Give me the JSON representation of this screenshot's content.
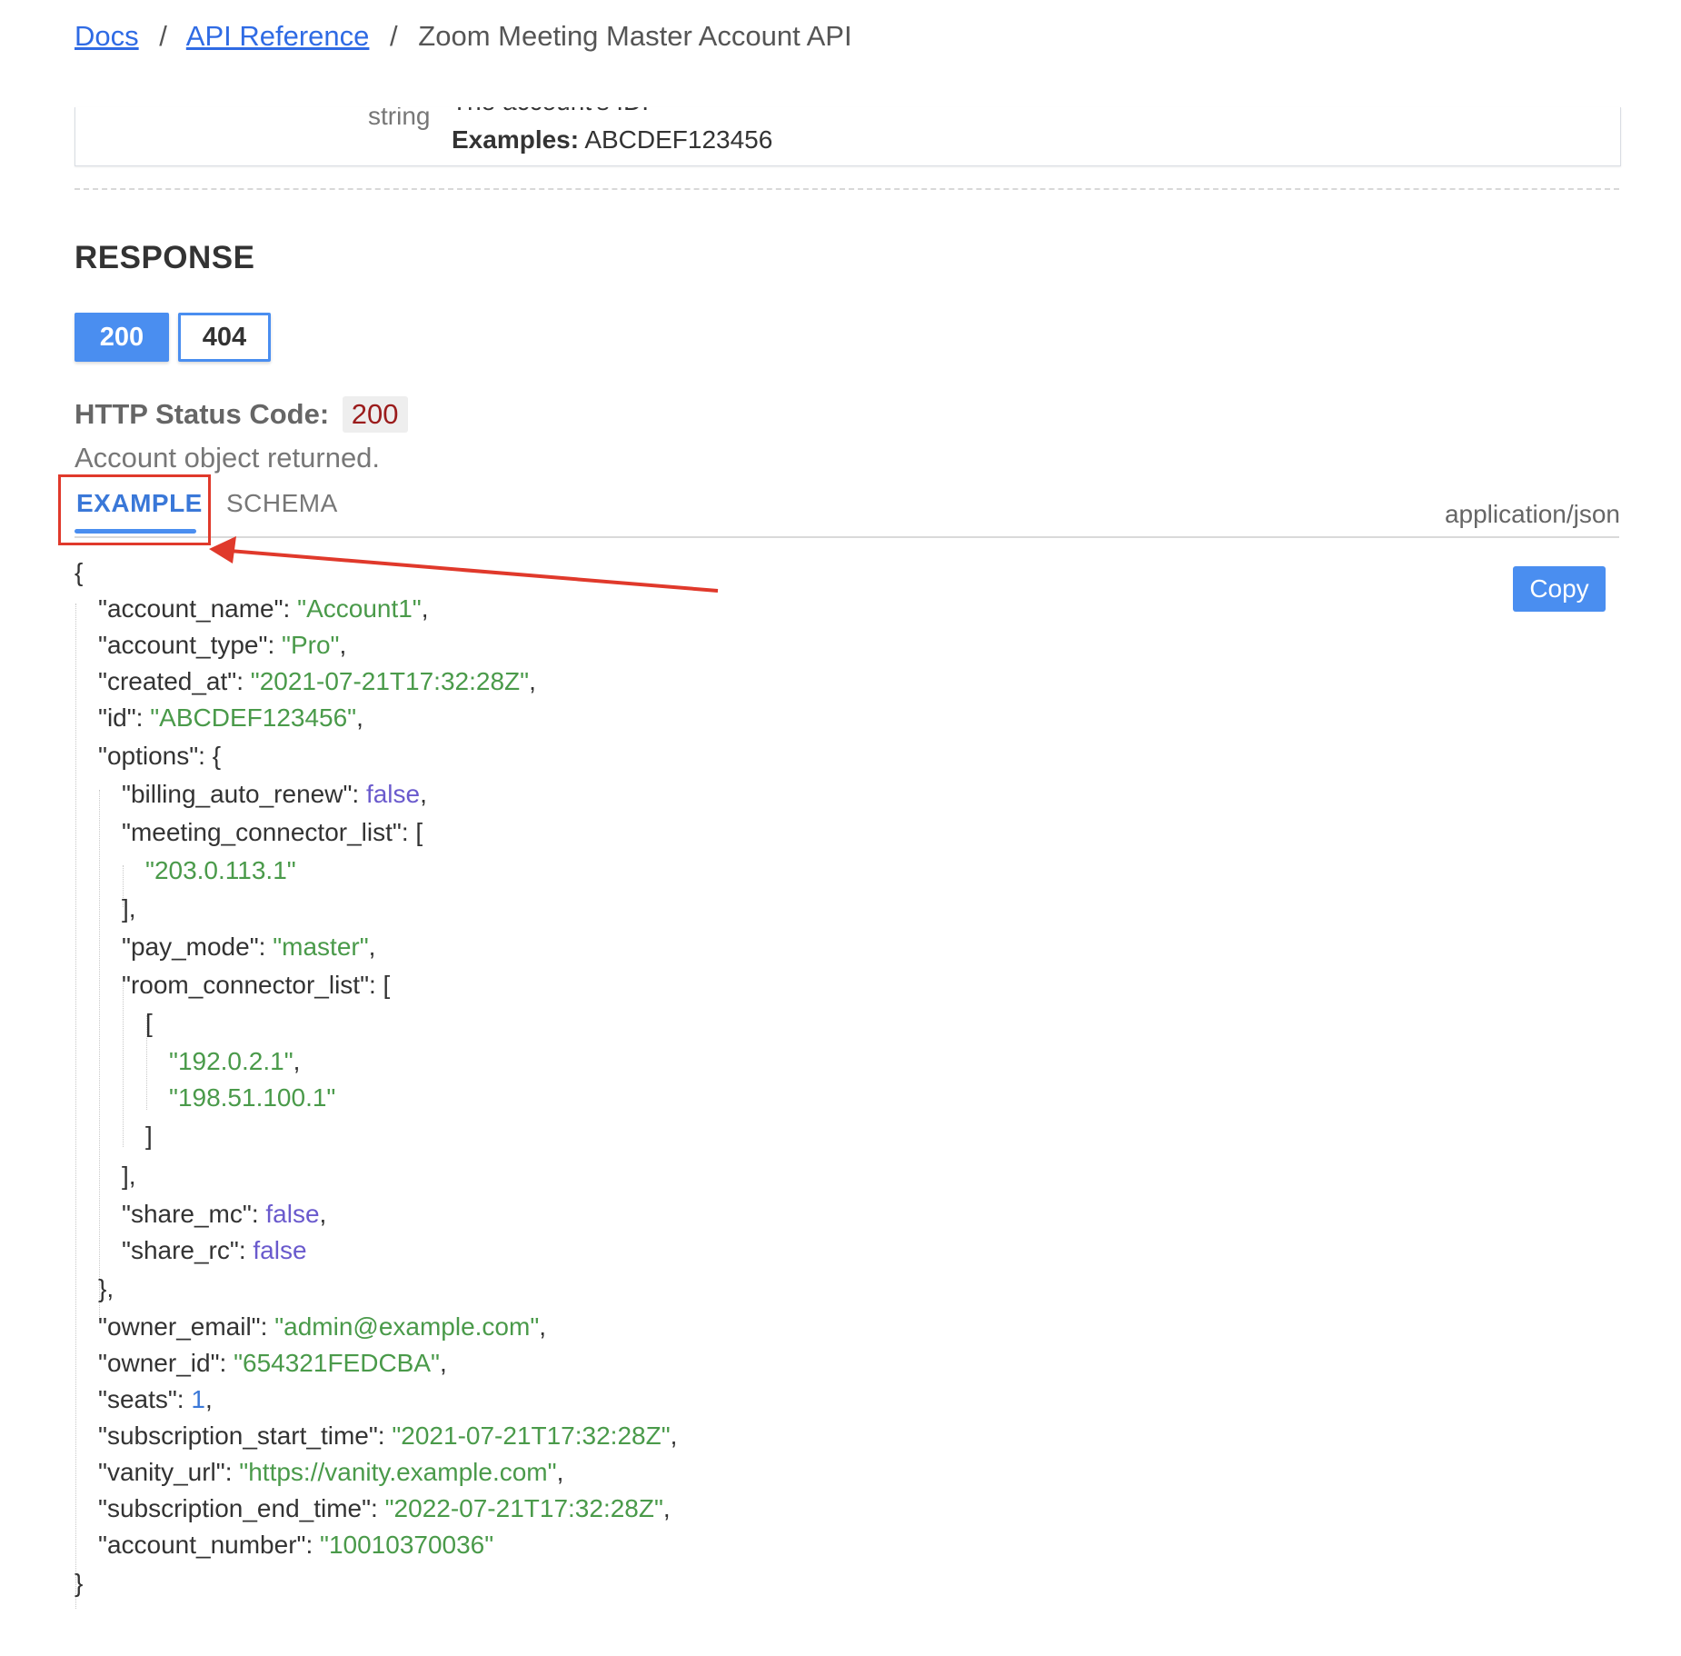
{
  "breadcrumb": {
    "docs": "Docs",
    "api_reference": "API Reference",
    "current": "Zoom Meeting Master Account API",
    "separator": "/"
  },
  "param": {
    "type": "string",
    "description_cut": "The account's ID.",
    "examples_label": "Examples:",
    "examples_value": "ABCDEF123456"
  },
  "response": {
    "title": "RESPONSE",
    "codes": [
      "200",
      "404"
    ],
    "status_label": "HTTP Status Code:",
    "status_value": "200",
    "status_description": "Account object returned.",
    "tabs": {
      "example": "EXAMPLE",
      "schema": "SCHEMA"
    },
    "content_type": "application/json",
    "copy_label": "Copy"
  },
  "json": {
    "open": "{",
    "close": "}",
    "account_name": "\"Account1\"",
    "account_type": "\"Pro\"",
    "created_at": "\"2021-07-21T17:32:28Z\"",
    "id": "\"ABCDEF123456\"",
    "billing_auto_renew": "false",
    "meeting_connector_ip": "\"203.0.113.1\"",
    "pay_mode": "\"master\"",
    "room_connector_ip_1": "\"192.0.2.1\"",
    "room_connector_ip_2": "\"198.51.100.1\"",
    "share_mc": "false",
    "share_rc": "false",
    "owner_email": "\"admin@example.com\"",
    "owner_id": "\"654321FEDCBA\"",
    "seats": "1",
    "subscription_start_time": "\"2021-07-21T17:32:28Z\"",
    "vanity_url": "\"https://vanity.example.com\"",
    "subscription_end_time": "\"2022-07-21T17:32:28Z\"",
    "account_number": "\"10010370036\""
  },
  "colors": {
    "accent": "#4a8ef0",
    "highlight": "#e0392b",
    "string": "#4a9a4a",
    "boolean": "#6a5acd",
    "number": "#3a78d8"
  }
}
